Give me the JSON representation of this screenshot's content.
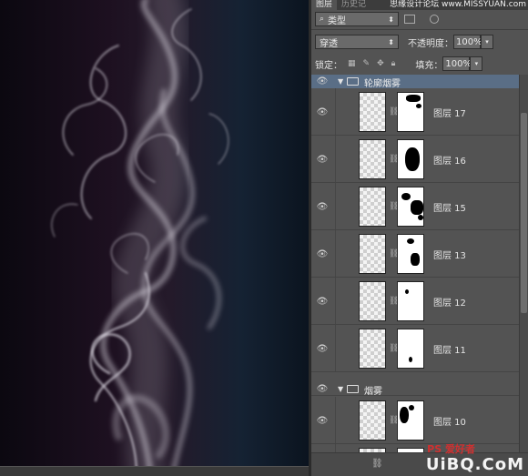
{
  "panel": {
    "tabs": [
      {
        "label": "图层",
        "active": true
      },
      {
        "label": "历史记",
        "active": false
      }
    ],
    "watermark_top": "思缘设计论坛 www.MISSYUAN.com",
    "filter_label": "类型",
    "blend_mode": "穿透",
    "opacity_label": "不透明度：",
    "opacity_value": "100%",
    "lock_label": "锁定：",
    "fill_label": "填充：",
    "fill_value": "100%"
  },
  "layers": {
    "group1_name": "轮廓烟雾",
    "group2_name": "烟雾",
    "items": [
      {
        "name": "图层 17"
      },
      {
        "name": "图层 16"
      },
      {
        "name": "图层 15"
      },
      {
        "name": "图层 13"
      },
      {
        "name": "图层 12"
      },
      {
        "name": "图层 11"
      },
      {
        "name": "图层 10"
      }
    ]
  },
  "watermark_bottom": "UiBQ.CoM",
  "watermark_ps": "PS 爱好者",
  "colors": {
    "panel_bg": "#535353",
    "selected_group": "#5a6e86",
    "canvas_dark": "#0b0810"
  },
  "icons": [
    "eye-icon",
    "folder-icon",
    "chain-link-icon",
    "search-icon",
    "lock-icon",
    "brush-icon",
    "move-icon",
    "checker-icon"
  ]
}
